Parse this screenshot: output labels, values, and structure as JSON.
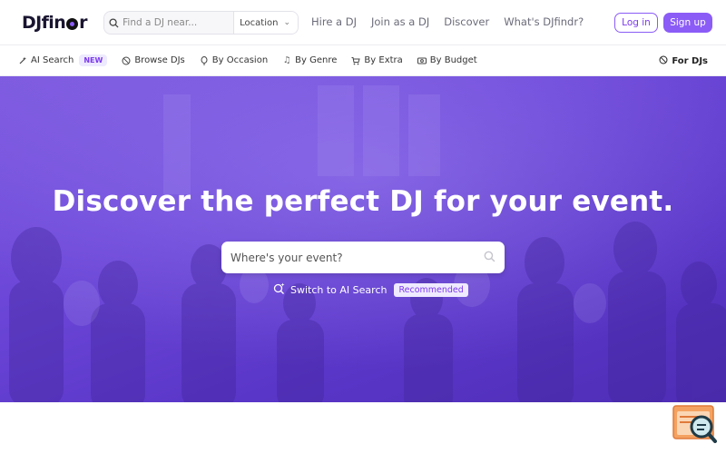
{
  "brand": {
    "logo_text_a": "DJfin",
    "logo_text_b": "r"
  },
  "header": {
    "search_placeholder": "Find a DJ near...",
    "location_label": "Location",
    "nav": [
      "Hire a DJ",
      "Join as a DJ",
      "Discover",
      "What's DJfindr?"
    ],
    "login_label": "Log in",
    "signup_label": "Sign up"
  },
  "catbar": {
    "items": [
      {
        "label": "AI Search",
        "icon": "sparkle-icon",
        "badge": "NEW"
      },
      {
        "label": "Browse DJs",
        "icon": "globe-icon"
      },
      {
        "label": "By Occasion",
        "icon": "balloon-icon"
      },
      {
        "label": "By Genre",
        "icon": "music-note-icon"
      },
      {
        "label": "By Extra",
        "icon": "cart-icon"
      },
      {
        "label": "By Budget",
        "icon": "money-icon"
      }
    ],
    "for_djs": "For DJs"
  },
  "hero": {
    "title": "Discover the perfect DJ for your event.",
    "search_placeholder": "Where's your event?",
    "switch_label": "Switch to AI Search",
    "recommended_badge": "Recommended"
  },
  "colors": {
    "accent": "#8b5cf6",
    "hero": "#6d48d9"
  }
}
